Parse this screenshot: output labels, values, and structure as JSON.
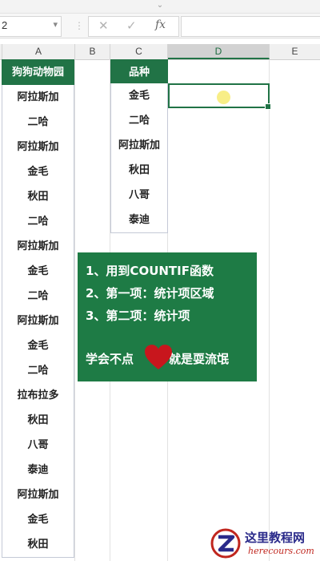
{
  "formula_bar": {
    "name_box": "2",
    "cancel_icon": "✕",
    "enter_icon": "✓",
    "function_icon": "fx",
    "formula_value": ""
  },
  "columns": [
    "A",
    "B",
    "C",
    "D",
    "E"
  ],
  "active_column": "D",
  "column_a": {
    "header": "狗狗动物园",
    "values": [
      "阿拉斯加",
      "二哈",
      "阿拉斯加",
      "金毛",
      "秋田",
      "二哈",
      "阿拉斯加",
      "金毛",
      "二哈",
      "阿拉斯加",
      "金毛",
      "二哈",
      "拉布拉多",
      "秋田",
      "八哥",
      "泰迪",
      "阿拉斯加",
      "金毛",
      "秋田"
    ]
  },
  "column_c": {
    "header": "品种",
    "values": [
      "金毛",
      "二哈",
      "阿拉斯加",
      "秋田",
      "八哥",
      "泰迪"
    ]
  },
  "selected_cell_value": "",
  "note_box": {
    "lines": [
      "1、用到COUNTIF函数",
      "2、第一项：统计项区域",
      "3、第二项：统计项"
    ],
    "like_left": "学会不点",
    "like_right": "就是耍流氓"
  },
  "watermark": {
    "title": "这里教程网",
    "url": "herecours.com"
  },
  "colors": {
    "header_green": "#217346",
    "note_green": "#1e7b45",
    "heart_red": "#c8161d"
  }
}
